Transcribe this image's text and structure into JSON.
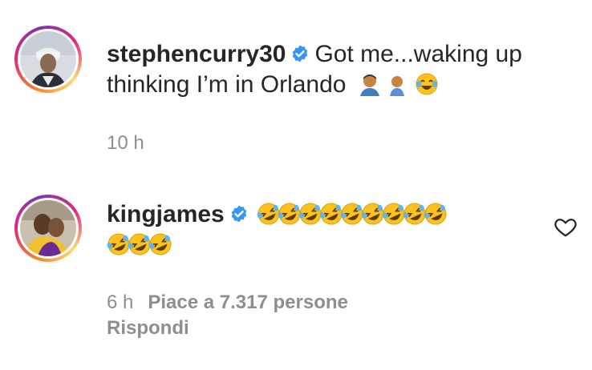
{
  "comments": [
    {
      "username": "stephencurry30",
      "text_line1": "Got me...waking up",
      "text_line2": "thinking I’m in Orlando",
      "time": "10 h"
    },
    {
      "username": "kingjames",
      "time": "6 h",
      "likes": "Piace a 7.317 persone",
      "reply_label": "Rispondi"
    }
  ],
  "icons": {
    "verified": "verified-badge-icon",
    "heart": "heart-outline-icon",
    "emoji_laugh": "rolling-on-floor-laughing-emoji",
    "emoji_joy": "face-with-tears-of-joy-emoji",
    "emoji_person": "man-emoji",
    "emoji_baby": "baby-emoji"
  },
  "colors": {
    "text": "#262626",
    "secondary": "#8e8e8e",
    "verified_blue": "#3897f0"
  }
}
